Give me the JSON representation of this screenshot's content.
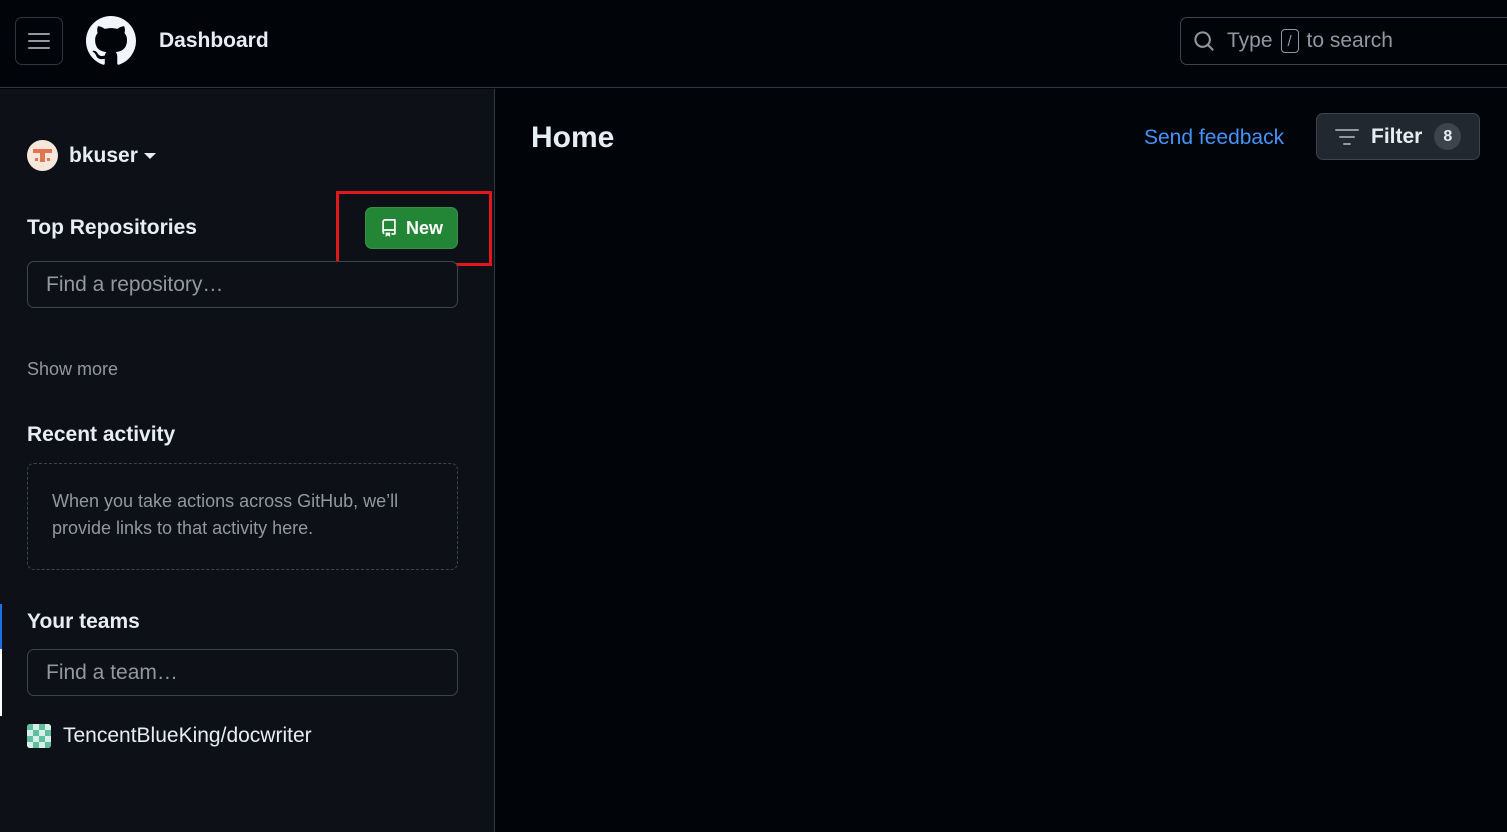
{
  "header": {
    "title": "Dashboard",
    "search": {
      "prefix": "Type",
      "key": "/",
      "suffix": "to search"
    }
  },
  "sidebar": {
    "username": "bkuser",
    "repos": {
      "title": "Top Repositories",
      "new_label": "New",
      "find_placeholder": "Find a repository…",
      "show_more": "Show more"
    },
    "activity": {
      "title": "Recent activity",
      "empty_text": "When you take actions across GitHub, we’ll provide links to that activity here."
    },
    "teams": {
      "title": "Your teams",
      "find_placeholder": "Find a team…",
      "items": [
        {
          "name": "TencentBlueKing/docwriter"
        }
      ]
    }
  },
  "main": {
    "title": "Home",
    "feedback_label": "Send feedback",
    "filter_label": "Filter",
    "filter_count": "8"
  },
  "colors": {
    "accent_link": "#4493f8",
    "new_button": "#238636",
    "highlight": "#e3171b"
  }
}
